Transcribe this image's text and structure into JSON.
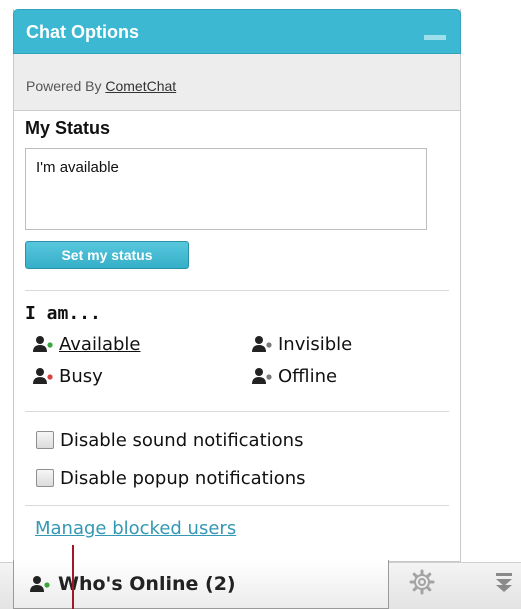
{
  "panel": {
    "title": "Chat Options",
    "powered_prefix": "Powered By ",
    "powered_brand": "CometChat"
  },
  "status": {
    "heading": "My Status",
    "message": "I'm available",
    "set_button": "Set my status"
  },
  "availability": {
    "heading": "I am...",
    "options": [
      {
        "label": "Available",
        "dot_color": "#3aa53a",
        "selected": true
      },
      {
        "label": "Invisible",
        "dot_color": "#7a7a7a",
        "selected": false
      },
      {
        "label": "Busy",
        "dot_color": "#d94040",
        "selected": false
      },
      {
        "label": "Offline",
        "dot_color": "#7a7a7a",
        "selected": false
      }
    ]
  },
  "notifications": {
    "sound_label": "Disable sound notifications",
    "sound_checked": false,
    "popup_label": "Disable popup notifications",
    "popup_checked": false
  },
  "links": {
    "manage_blocked": "Manage blocked users"
  },
  "bar": {
    "whos_online_label": "Who's Online (2)",
    "gear_icon": "gear-icon",
    "collapse_icon": "double-chevron-down-icon"
  },
  "colors": {
    "accent": "#3cb8d2",
    "link": "#3398b3"
  }
}
